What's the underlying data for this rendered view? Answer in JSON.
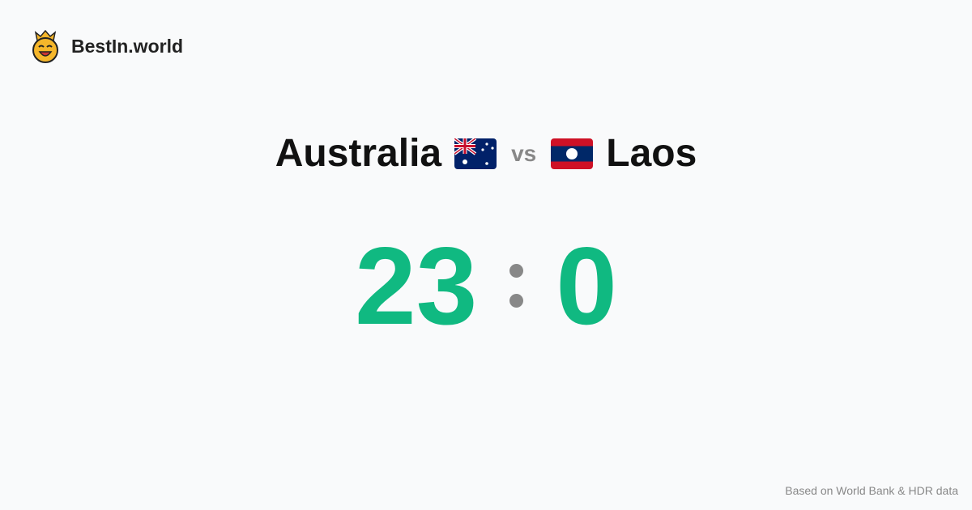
{
  "brand": {
    "name": "BestIn.world"
  },
  "comparison": {
    "left": "Australia",
    "vs": "vs",
    "right": "Laos",
    "left_score": "23",
    "right_score": "0",
    "score_color": "#10b981"
  },
  "footer": "Based on World Bank & HDR data"
}
